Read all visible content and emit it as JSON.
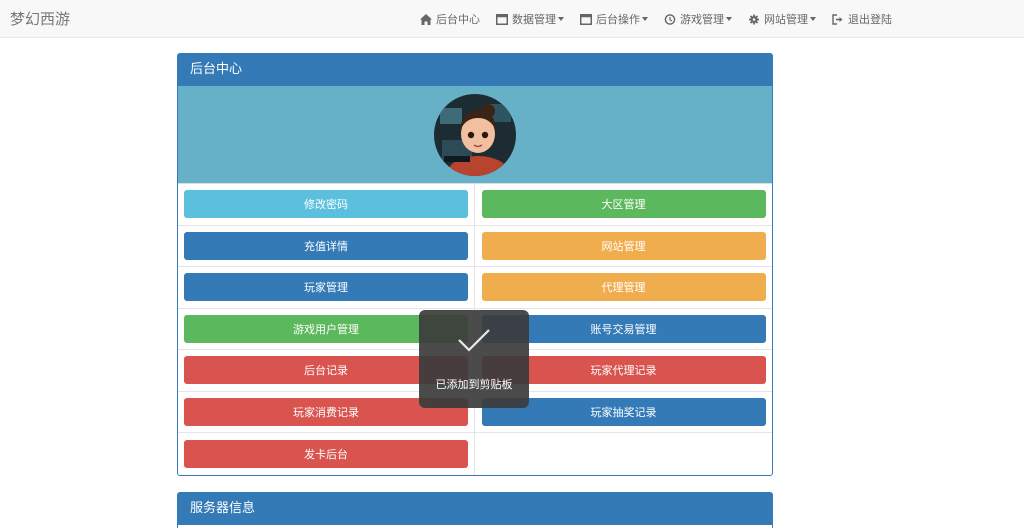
{
  "navbar": {
    "brand": "梦幻西游",
    "items": [
      {
        "label": "后台中心",
        "icon": "home-icon",
        "dropdown": false
      },
      {
        "label": "数据管理",
        "icon": "window-icon",
        "dropdown": true
      },
      {
        "label": "后台操作",
        "icon": "window-icon",
        "dropdown": true
      },
      {
        "label": "游戏管理",
        "icon": "clock-icon",
        "dropdown": true
      },
      {
        "label": "网站管理",
        "icon": "gear-icon",
        "dropdown": true
      },
      {
        "label": "退出登陆",
        "icon": "logout-icon",
        "dropdown": false
      }
    ]
  },
  "panel_main": {
    "title": "后台中心",
    "avatar_icon": "avatar-image",
    "buttons": [
      {
        "label": "修改密码",
        "color": "#5bc0de"
      },
      {
        "label": "大区管理",
        "color": "#5cb85c"
      },
      {
        "label": "充值详情",
        "color": "#337ab7"
      },
      {
        "label": "网站管理",
        "color": "#f0ad4e"
      },
      {
        "label": "玩家管理",
        "color": "#337ab7"
      },
      {
        "label": "代理管理",
        "color": "#f0ad4e"
      },
      {
        "label": "游戏用户管理",
        "color": "#5cb85c"
      },
      {
        "label": "账号交易管理",
        "color": "#337ab7"
      },
      {
        "label": "后台记录",
        "color": "#d9534f"
      },
      {
        "label": "玩家代理记录",
        "color": "#d9534f"
      },
      {
        "label": "玩家消费记录",
        "color": "#d9534f"
      },
      {
        "label": "玩家抽奖记录",
        "color": "#337ab7"
      },
      {
        "label": "发卡后台",
        "color": "#d9534f"
      }
    ]
  },
  "panel_server": {
    "title": "服务器信息"
  },
  "toast": {
    "message": "已添加到剪贴板",
    "icon": "check-icon"
  },
  "colors": {
    "primary": "#337ab7",
    "info": "#5bc0de",
    "success": "#5cb85c",
    "warning": "#f0ad4e",
    "danger": "#d9534f",
    "avatar_bg": "#67b1c8"
  }
}
